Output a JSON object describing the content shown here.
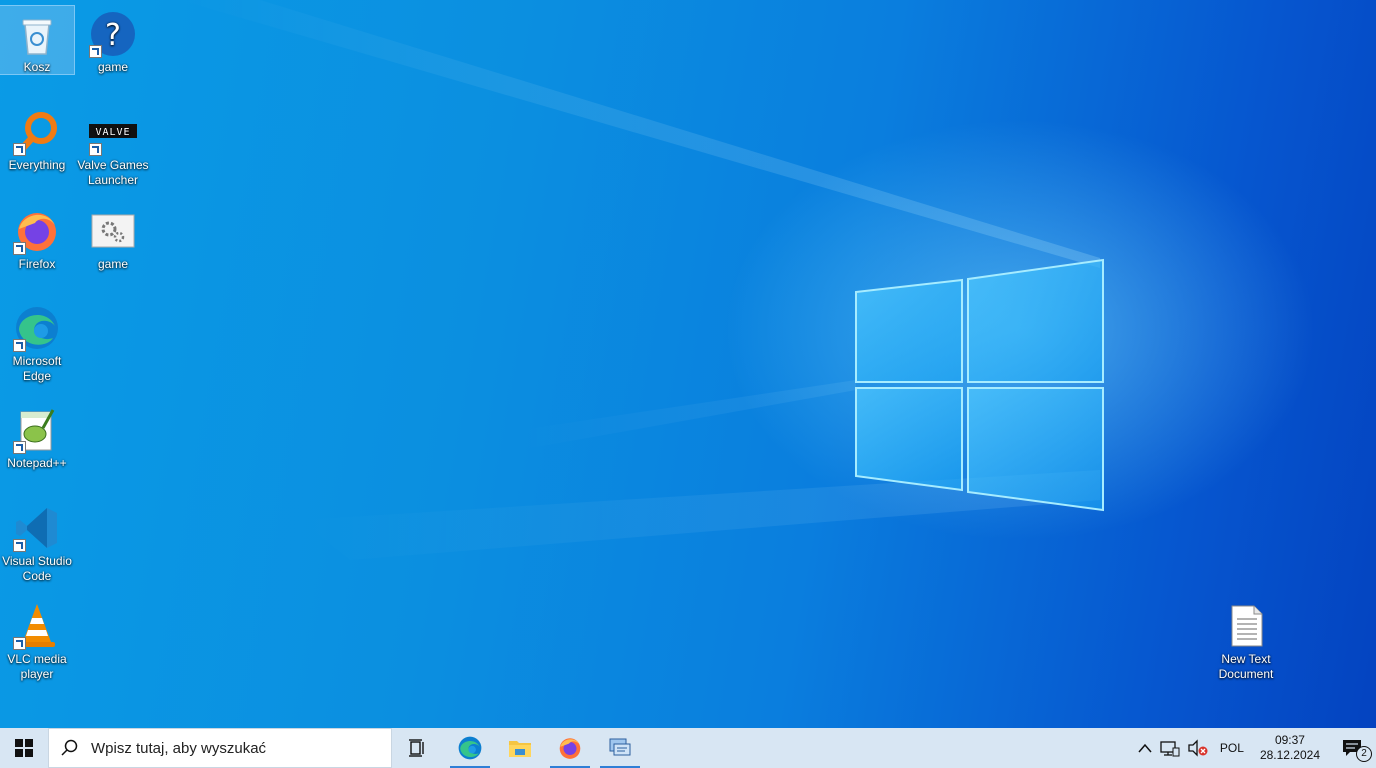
{
  "desktop": {
    "icons": [
      {
        "label": "Kosz",
        "icon": "recycle-bin-icon"
      },
      {
        "label": "game",
        "icon": "help-question-icon"
      },
      {
        "label": "Everything",
        "icon": "everything-search-icon"
      },
      {
        "label": "Valve Games Launcher",
        "icon": "valve-icon",
        "logo_text": "VALVE"
      },
      {
        "label": "Firefox",
        "icon": "firefox-icon"
      },
      {
        "label": "game",
        "icon": "gear-window-icon"
      },
      {
        "label": "Microsoft Edge",
        "icon": "edge-icon"
      },
      {
        "label": "Notepad++",
        "icon": "notepad-plus-plus-icon"
      },
      {
        "label": "Visual Studio Code",
        "icon": "vscode-icon"
      },
      {
        "label": "VLC media player",
        "icon": "vlc-cone-icon"
      },
      {
        "label": "New Text Document",
        "icon": "text-document-icon"
      }
    ]
  },
  "taskbar": {
    "start_icon": "windows-logo-icon",
    "search_placeholder": "Wpisz tutaj, aby wyszukać",
    "search_icon": "search-icon",
    "task_view_icon": "task-view-icon",
    "pinned": [
      {
        "name": "Microsoft Edge",
        "icon": "edge-icon",
        "running": true
      },
      {
        "name": "File Explorer",
        "icon": "folder-icon",
        "running": false
      },
      {
        "name": "Firefox",
        "icon": "firefox-icon",
        "running": true
      },
      {
        "name": "Remote Desktop",
        "icon": "remote-desktop-icon",
        "running": true
      }
    ],
    "tray": {
      "language": "POL",
      "time": "09:37",
      "date": "28.12.2024",
      "notification_count": "2"
    }
  },
  "colors": {
    "wallpaper_light": "#0a9be6",
    "wallpaper_dark": "#0443c0",
    "taskbar": "#d8e6f3",
    "accent": "#2f7fd6"
  }
}
